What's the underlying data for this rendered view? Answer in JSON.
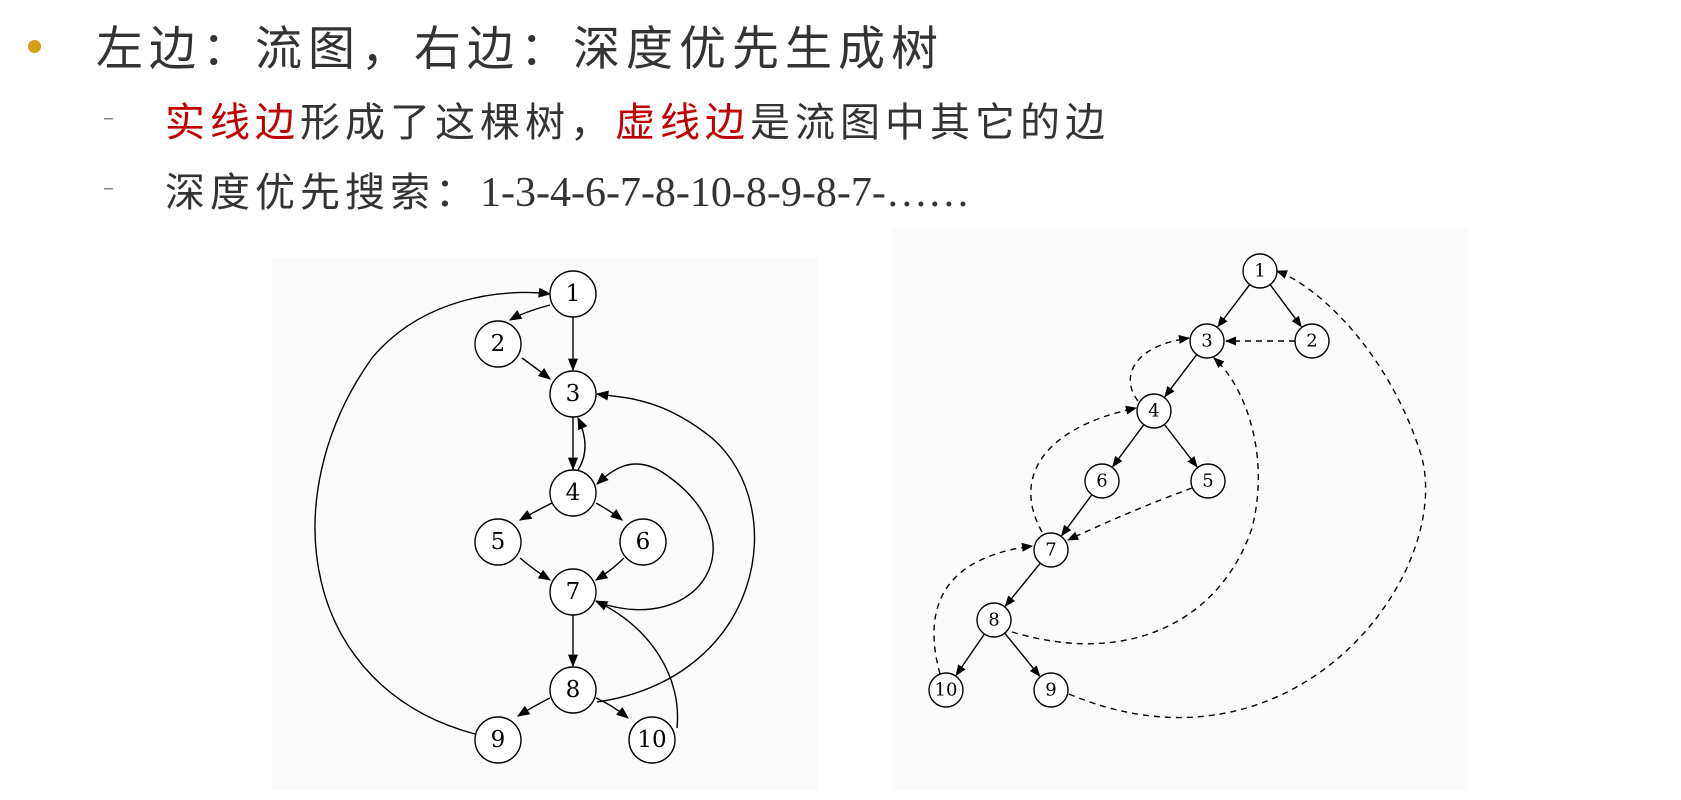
{
  "heading": {
    "text": "左边：流图，右边：深度优先生成树"
  },
  "bullets": [
    {
      "dash": "–",
      "parts": [
        {
          "text": "实线边",
          "color": "#c00000"
        },
        {
          "text": "形成了这棵树，",
          "color": "#333333"
        },
        {
          "text": "虚线边",
          "color": "#c00000"
        },
        {
          "text": "是流图中其它的边",
          "color": "#333333"
        }
      ]
    },
    {
      "dash": "–",
      "label": "深度优先搜索：",
      "sequence": "1-3-4-6-7-8-10-8-9-8-7-……"
    }
  ],
  "colors": {
    "bullet": "#d4a017",
    "highlight": "#c00000",
    "text": "#333333"
  },
  "flow_graph": {
    "nodes": [
      "1",
      "2",
      "3",
      "4",
      "5",
      "6",
      "7",
      "8",
      "9",
      "10"
    ],
    "edges": [
      {
        "from": "1",
        "to": "2"
      },
      {
        "from": "1",
        "to": "3"
      },
      {
        "from": "2",
        "to": "3"
      },
      {
        "from": "3",
        "to": "4"
      },
      {
        "from": "4",
        "to": "3"
      },
      {
        "from": "4",
        "to": "5"
      },
      {
        "from": "4",
        "to": "6"
      },
      {
        "from": "5",
        "to": "7"
      },
      {
        "from": "6",
        "to": "7"
      },
      {
        "from": "7",
        "to": "4"
      },
      {
        "from": "7",
        "to": "8"
      },
      {
        "from": "8",
        "to": "3"
      },
      {
        "from": "8",
        "to": "9"
      },
      {
        "from": "8",
        "to": "10"
      },
      {
        "from": "9",
        "to": "1"
      },
      {
        "from": "10",
        "to": "7"
      }
    ]
  },
  "dfs_tree": {
    "nodes": [
      "1",
      "2",
      "3",
      "4",
      "5",
      "6",
      "7",
      "8",
      "9",
      "10"
    ],
    "tree_edges": [
      {
        "from": "1",
        "to": "3"
      },
      {
        "from": "1",
        "to": "2"
      },
      {
        "from": "3",
        "to": "4"
      },
      {
        "from": "4",
        "to": "6"
      },
      {
        "from": "4",
        "to": "5"
      },
      {
        "from": "6",
        "to": "7"
      },
      {
        "from": "7",
        "to": "8"
      },
      {
        "from": "8",
        "to": "10"
      },
      {
        "from": "8",
        "to": "9"
      }
    ],
    "other_edges": [
      {
        "from": "2",
        "to": "3"
      },
      {
        "from": "4",
        "to": "3"
      },
      {
        "from": "5",
        "to": "7"
      },
      {
        "from": "7",
        "to": "4"
      },
      {
        "from": "8",
        "to": "3"
      },
      {
        "from": "9",
        "to": "1"
      },
      {
        "from": "10",
        "to": "7"
      }
    ]
  }
}
